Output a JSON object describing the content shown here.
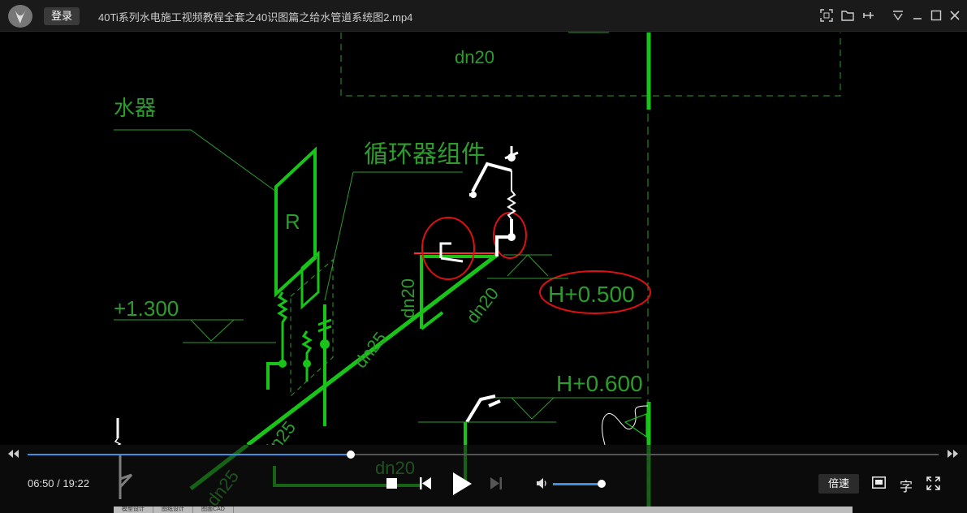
{
  "window": {
    "title": "40Ti系列水电施工视频教程全套之40识图篇之给水管道系统图2.mp4",
    "login_label": "登录"
  },
  "cad": {
    "label_heater": "水器",
    "label_circulator": "循环器组件",
    "label_R": "R",
    "elev_1300": "+1.300",
    "elev_0500": "H+0.500",
    "elev_0600": "H+0.600",
    "pipe_dn20_top": "dn20",
    "pipe_dn20_vert": "dn20",
    "pipe_dn20_diag": "dn20",
    "pipe_dn25_a": "dn25",
    "pipe_dn25_b": "dn25",
    "pipe_dn25_c": "dn25",
    "pipe_dn20_bottom": "dn20"
  },
  "player": {
    "progress": 0.355,
    "current_time": "06:50",
    "duration": "19:22",
    "time_separator": " / ",
    "volume": 1.0,
    "speed_label": "倍速",
    "subtitle_label": "字"
  },
  "bottom_tabs": [
    "模型设计",
    "图纸设计",
    "图面CAD"
  ],
  "colors": {
    "pipe": "#19c419",
    "annot": "#2d9c2d",
    "markup": "#e01010",
    "accent": "#3d8fe6"
  }
}
